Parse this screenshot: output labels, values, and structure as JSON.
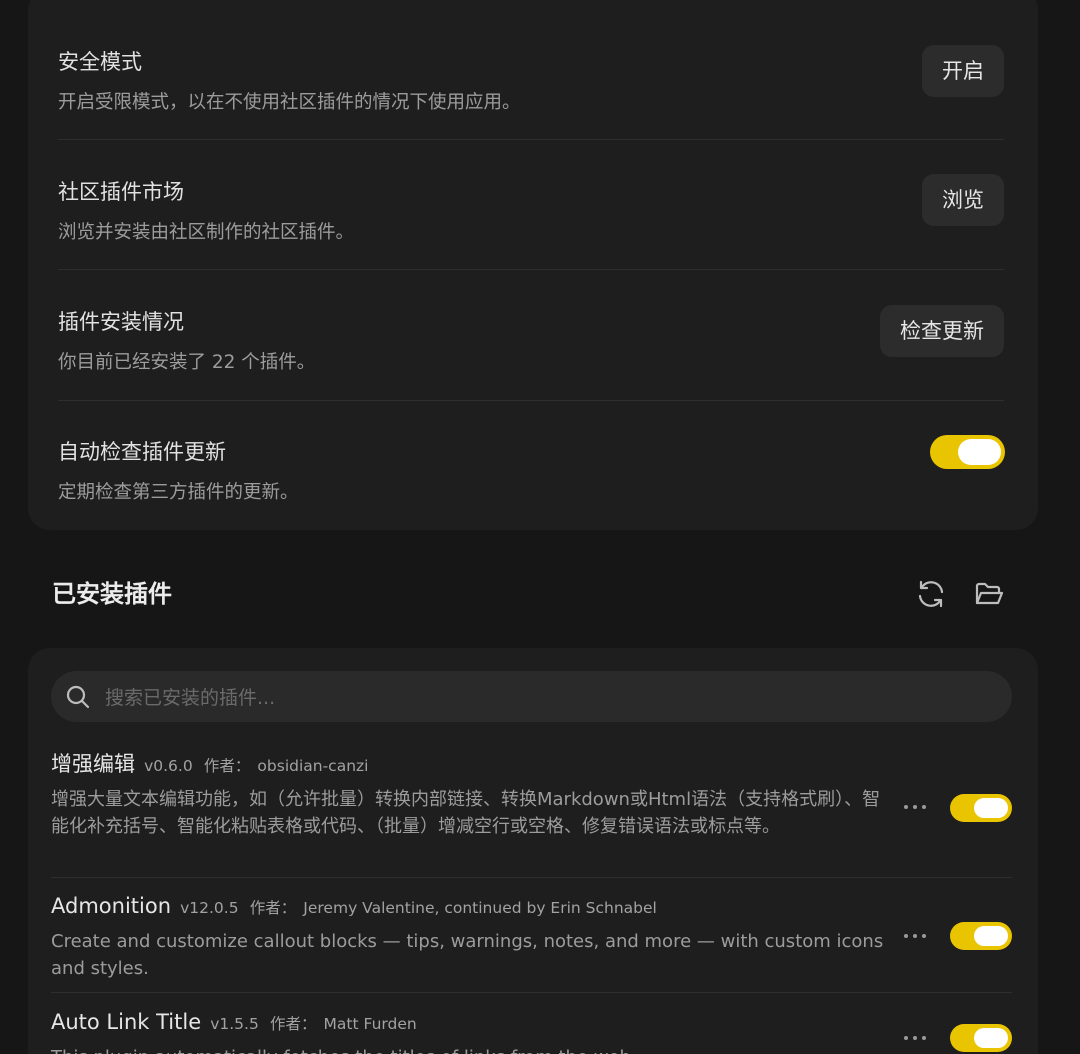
{
  "settings": {
    "safe_mode": {
      "name": "安全模式",
      "desc": "开启受限模式，以在不使用社区插件的情况下使用应用。",
      "button": "开启"
    },
    "community_market": {
      "name": "社区插件市场",
      "desc": "浏览并安装由社区制作的社区插件。",
      "button": "浏览"
    },
    "install_status": {
      "name": "插件安装情况",
      "desc": "你目前已经安装了 22 个插件。",
      "button": "检查更新"
    },
    "auto_check": {
      "name": "自动检查插件更新",
      "desc": "定期检查第三方插件的更新。",
      "enabled": true
    }
  },
  "installed": {
    "title": "已安装插件",
    "reload_icon": "reload-icon",
    "folder_icon": "folder-open-icon"
  },
  "search": {
    "placeholder": "搜索已安装的插件...",
    "value": ""
  },
  "plugins": [
    {
      "name": "增强编辑",
      "version": "v0.6.0",
      "author_label": "作者：",
      "author": "obsidian-canzi",
      "desc": "增强大量文本编辑功能，如（允许批量）转换内部链接、转换Markdown或Html语法（支持格式刷）、智能化补充括号、智能化粘贴表格或代码、（批量）增减空行或空格、修复错误语法或标点等。",
      "enabled": true
    },
    {
      "name": "Admonition",
      "version": "v12.0.5",
      "author_label": "作者：",
      "author": "Jeremy Valentine, continued by Erin Schnabel",
      "desc": "Create and customize callout blocks — tips, warnings, notes, and more — with custom icons and styles.",
      "enabled": true
    },
    {
      "name": "Auto Link Title",
      "version": "v1.5.5",
      "author_label": "作者：",
      "author": "Matt Furden",
      "desc": "This plugin automatically fetches the titles of links from the web",
      "enabled": true
    }
  ],
  "colors": {
    "accent": "#e9c400",
    "background": "#161616",
    "card": "#1e1e1e"
  }
}
